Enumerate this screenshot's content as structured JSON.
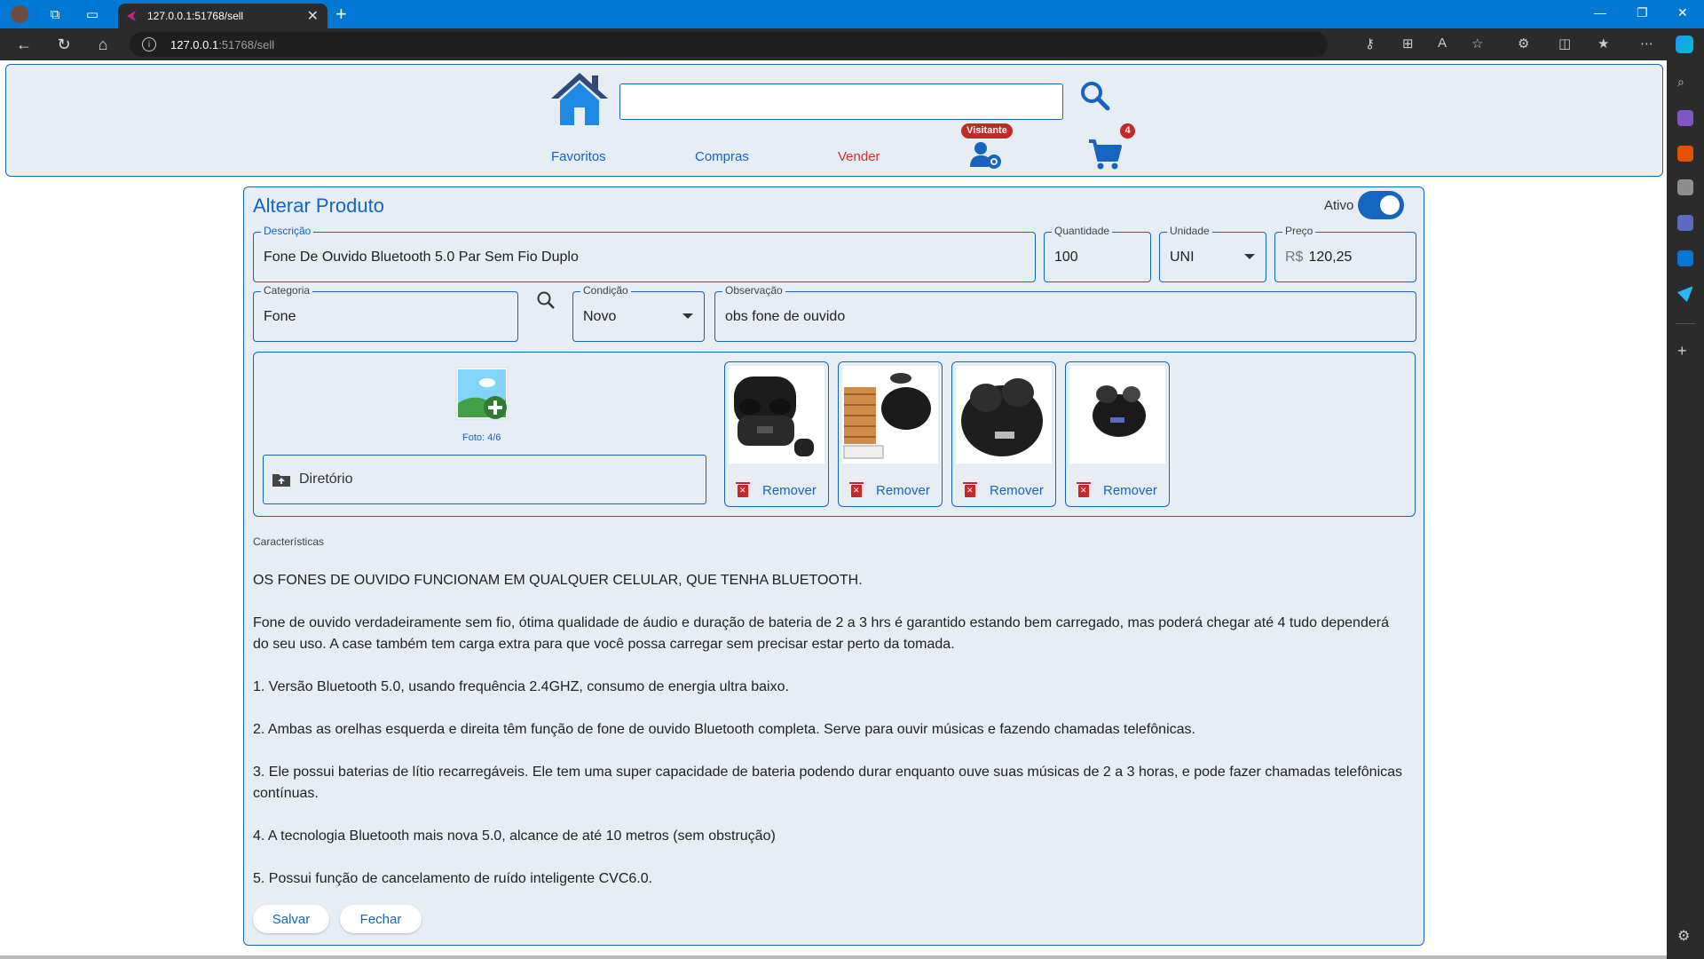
{
  "browser": {
    "tab_title": "127.0.0.1:51768/sell",
    "url_host": "127.0.0.1",
    "url_rest": ":51768/sell"
  },
  "header": {
    "nav": {
      "favoritos": "Favoritos",
      "compras": "Compras",
      "vender": "Vender"
    },
    "user_badge": "Visitante",
    "cart_count": "4"
  },
  "form": {
    "title": "Alterar Produto",
    "ativo_label": "Ativo",
    "ativo_on": true,
    "descricao": {
      "label": "Descrição",
      "value": "Fone De Ouvido Bluetooth 5.0 Par Sem Fio Duplo"
    },
    "quantidade": {
      "label": "Quantidade",
      "value": "100"
    },
    "unidade": {
      "label": "Unidade",
      "value": "UNI"
    },
    "preco": {
      "label": "Preço",
      "prefix": "R$",
      "value": "120,25"
    },
    "categoria": {
      "label": "Categoria",
      "value": "Fone"
    },
    "condicao": {
      "label": "Condição",
      "value": "Novo"
    },
    "observacao": {
      "label": "Observação",
      "value": "obs fone de ouvido"
    },
    "photos": {
      "count_label": "Foto: 4/6",
      "directory_label": "Diretório",
      "remove_label": "Remover"
    },
    "caracteristicas_label": "Características",
    "caracteristicas": [
      "OS FONES DE OUVIDO FUNCIONAM EM QUALQUER CELULAR, QUE TENHA BLUETOOTH.",
      "Fone de ouvido verdadeiramente sem fio, ótima qualidade de áudio e duração de bateria de 2 a 3 hrs é garantido estando bem carregado, mas poderá chegar até 4 tudo dependerá do seu uso. A case também tem carga extra para que você possa carregar sem precisar estar perto da tomada.",
      "1. Versão Bluetooth 5.0, usando frequência 2.4GHZ, consumo de energia ultra baixo.",
      "2. Ambas as orelhas esquerda e direita têm função de fone de ouvido Bluetooth completa. Serve para ouvir músicas e fazendo chamadas telefônicas.",
      "3. Ele possui baterias de lítio recarregáveis. Ele tem uma super capacidade de bateria podendo durar enquanto ouve suas músicas de 2 a 3 horas, e pode fazer chamadas telefônicas contínuas.",
      "4. A tecnologia Bluetooth mais nova 5.0, alcance de até 10 metros (sem obstrução)",
      "5. Possui função de cancelamento de ruído inteligente CVC6.0."
    ],
    "save_label": "Salvar",
    "close_label": "Fechar"
  },
  "colors": {
    "primary": "#1565c0",
    "active_nav": "#d32f2f",
    "badge": "#c62828",
    "background": "#e6edf5"
  }
}
